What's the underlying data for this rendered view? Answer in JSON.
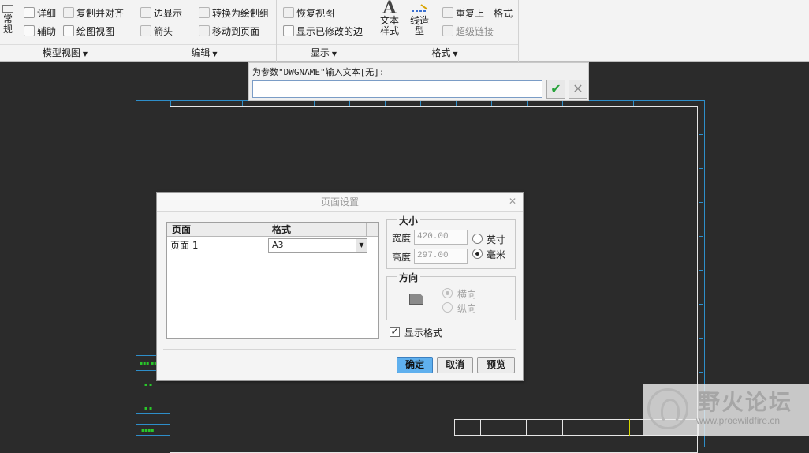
{
  "ribbon": {
    "groups": {
      "model_view": {
        "label": "模型视图"
      },
      "edit": {
        "label": "编辑"
      },
      "display": {
        "label": "显示"
      },
      "format": {
        "label": "格式"
      }
    },
    "items": {
      "general": "常规",
      "detail": "详细",
      "copy_align": "复制并对齐",
      "auxiliary": "辅助",
      "drawing_view": "绘图视图",
      "edge_display": "边显示",
      "convert_to_drawing": "转换为绘制组",
      "arrow": "箭头",
      "move_to_page": "移动到页面",
      "restore_view": "恢复视图",
      "show_modified_edges": "显示已修改的边",
      "text_style": "文本样式",
      "line_type": "线造型",
      "repeat_last_format": "重复上一格式",
      "hyperlink": "超级链接"
    }
  },
  "prompt": {
    "label": "为参数\"DWGNAME\"输入文本[无]:",
    "value": ""
  },
  "dialog": {
    "title": "页面设置",
    "table": {
      "headers": [
        "页面",
        "格式"
      ],
      "rows": [
        {
          "page": "页面 1",
          "format": "A3"
        }
      ]
    },
    "size": {
      "legend": "大小",
      "width_label": "宽度",
      "width_value": "420.00",
      "height_label": "高度",
      "height_value": "297.00",
      "unit_inch": "英寸",
      "unit_mm": "毫米",
      "selected_unit": "毫米"
    },
    "orientation": {
      "legend": "方向",
      "landscape": "横向",
      "portrait": "纵向",
      "selected": "横向"
    },
    "show_format": {
      "label": "显示格式",
      "checked": true
    },
    "buttons": {
      "ok": "确定",
      "cancel": "取消",
      "preview": "预览"
    }
  },
  "watermark": {
    "title": "野火论坛",
    "url": "www.proewildfire.cn"
  },
  "colors": {
    "canvas": "#2b2b2b",
    "frame_blue": "#2e8ec9",
    "accent_button": "#5fb0ee",
    "confirm_green": "#27a33a"
  }
}
